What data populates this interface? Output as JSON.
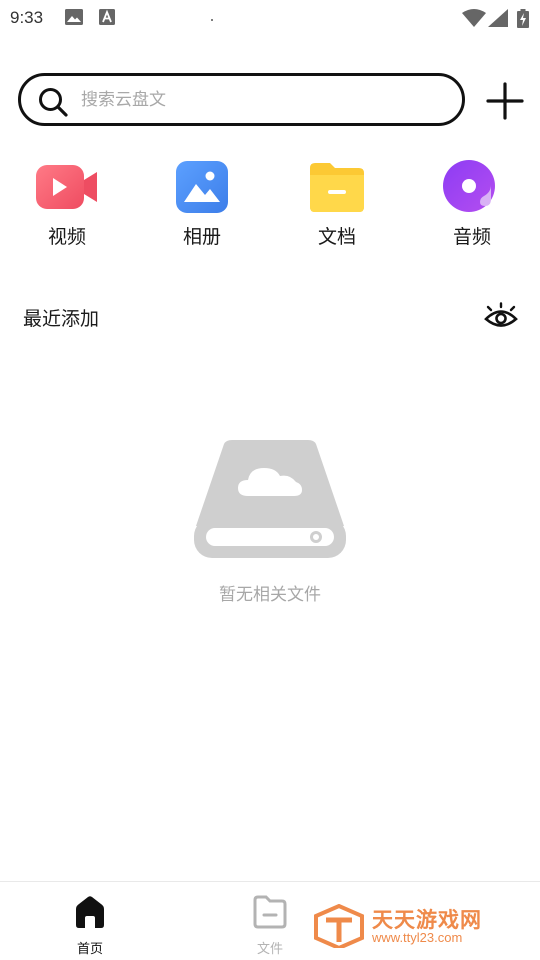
{
  "status_bar": {
    "time": "9:33",
    "icons": [
      "image-icon",
      "text-a-icon",
      "wifi-icon",
      "cellular-signal-icon",
      "battery-charging-icon"
    ]
  },
  "search": {
    "placeholder": "搜索云盘文",
    "value": ""
  },
  "categories": [
    {
      "label": "视频",
      "icon": "video-icon",
      "color": "#f0566b"
    },
    {
      "label": "相册",
      "icon": "album-icon",
      "color": "#4b8bf5"
    },
    {
      "label": "文档",
      "icon": "document-folder-icon",
      "color": "#fccc3a"
    },
    {
      "label": "音频",
      "icon": "audio-disc-icon",
      "color": "#9b3df0"
    }
  ],
  "recent": {
    "title": "最近添加",
    "toggle_icon": "eye-icon"
  },
  "empty_state": {
    "icon": "cloud-drive-icon",
    "text": "暂无相关文件"
  },
  "bottom_nav": {
    "items": [
      {
        "label": "首页",
        "icon": "home-icon",
        "active": true,
        "color": "#111111"
      },
      {
        "label": "文件",
        "icon": "file-folder-icon",
        "active": false,
        "color": "#b3b3b3"
      }
    ]
  },
  "watermark": {
    "line1": "天天游戏网",
    "line2": "www.ttyl23.com",
    "color": "#ef8a4a"
  }
}
